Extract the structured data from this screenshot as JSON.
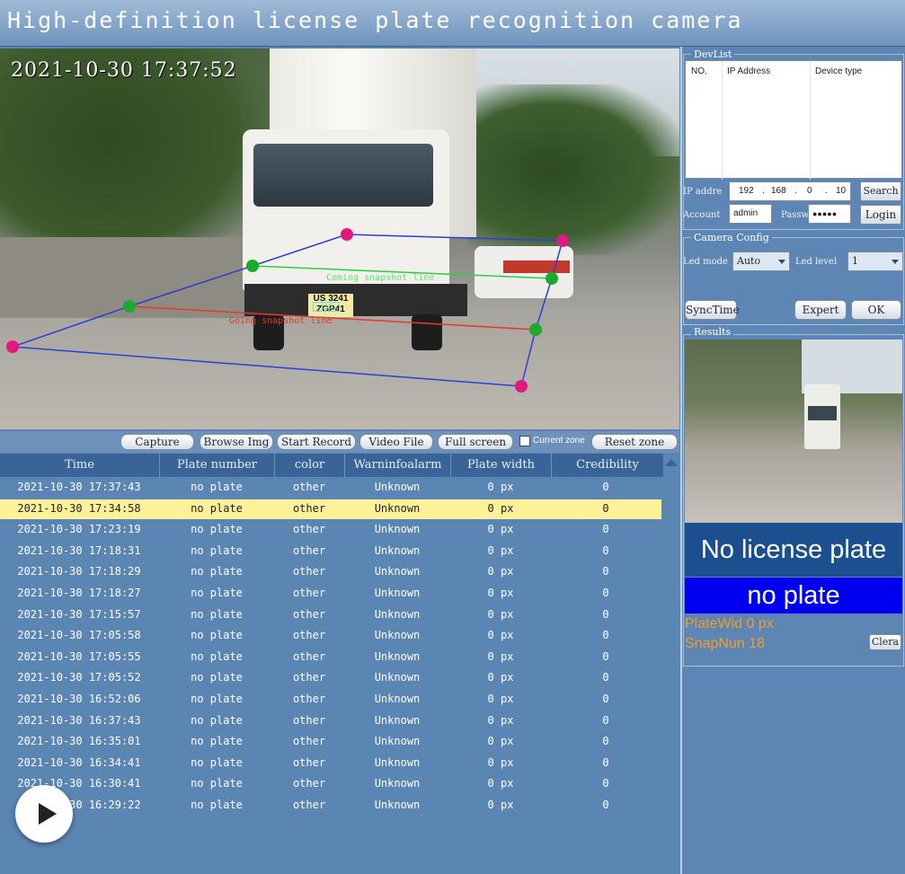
{
  "window": {
    "title": "High-definition license plate recognition camera"
  },
  "video": {
    "timestamp": "2021-10-30 17:37:52",
    "plate_text": "US 3241",
    "plate_text2": "ZGP41",
    "coming_label": "Coming  snapshot line",
    "going_label": "Going snapshot line",
    "mark_label": "-110-",
    "colors": {
      "region": "#2b3fd6",
      "coming": "#2ecc40",
      "going": "#e53b2b",
      "handle_end": "#e0197d",
      "handle_mid": "#1aaa2c"
    }
  },
  "toolbar": {
    "capture": "Capture",
    "browse": "Browse Img",
    "record": "Start Record",
    "video_file": "Video File",
    "full_screen": "Full screen",
    "current_zone": "Current zone",
    "reset_zone": "Reset zone"
  },
  "table": {
    "headers": [
      "Time",
      "Plate number",
      "color",
      "Warninfoalarm",
      "Plate width",
      "Credibility"
    ],
    "selected_index": 1,
    "rows": [
      [
        "2021-10-30 17:37:43",
        "no plate",
        "other",
        "Unknown",
        "0 px",
        "0"
      ],
      [
        "2021-10-30 17:34:58",
        "no plate",
        "other",
        "Unknown",
        "0 px",
        "0"
      ],
      [
        "2021-10-30 17:23:19",
        "no plate",
        "other",
        "Unknown",
        "0 px",
        "0"
      ],
      [
        "2021-10-30 17:18:31",
        "no plate",
        "other",
        "Unknown",
        "0 px",
        "0"
      ],
      [
        "2021-10-30 17:18:29",
        "no plate",
        "other",
        "Unknown",
        "0 px",
        "0"
      ],
      [
        "2021-10-30 17:18:27",
        "no plate",
        "other",
        "Unknown",
        "0 px",
        "0"
      ],
      [
        "2021-10-30 17:15:57",
        "no plate",
        "other",
        "Unknown",
        "0 px",
        "0"
      ],
      [
        "2021-10-30 17:05:58",
        "no plate",
        "other",
        "Unknown",
        "0 px",
        "0"
      ],
      [
        "2021-10-30 17:05:55",
        "no plate",
        "other",
        "Unknown",
        "0 px",
        "0"
      ],
      [
        "2021-10-30 17:05:52",
        "no plate",
        "other",
        "Unknown",
        "0 px",
        "0"
      ],
      [
        "2021-10-30 16:52:06",
        "no plate",
        "other",
        "Unknown",
        "0 px",
        "0"
      ],
      [
        "2021-10-30 16:37:43",
        "no plate",
        "other",
        "Unknown",
        "0 px",
        "0"
      ],
      [
        "2021-10-30 16:35:01",
        "no plate",
        "other",
        "Unknown",
        "0 px",
        "0"
      ],
      [
        "2021-10-30 16:34:41",
        "no plate",
        "other",
        "Unknown",
        "0 px",
        "0"
      ],
      [
        "2021-10-30 16:30:41",
        "no plate",
        "other",
        "Unknown",
        "0 px",
        "0"
      ],
      [
        "2021-10-30 16:29:22",
        "no plate",
        "other",
        "Unknown",
        "0 px",
        "0"
      ]
    ]
  },
  "devlist": {
    "label": "DevList",
    "col_no": "NO.",
    "col_ip": "IP Address",
    "col_type": "Device type",
    "ip_label": "IP addre",
    "ip": [
      "192",
      "168",
      "0",
      "10"
    ],
    "account_label": "Account",
    "account_value": "admin",
    "password_label": "Passw",
    "password_value": "●●●●●",
    "search": "Search",
    "login": "Login"
  },
  "camera_config": {
    "label": "Camera Config",
    "led_mode_label": "Led mode",
    "led_mode_value": "Auto",
    "led_level_label": "Led level",
    "led_level_value": "1",
    "sync_time": "SyncTime",
    "expert": "Expert",
    "ok": "OK"
  },
  "results": {
    "label": "Results",
    "no_license": "No license plate",
    "no_plate": "no plate",
    "plate_width": "PlateWid 0 px",
    "snap_num": "SnapNun 18",
    "clear": "Clera"
  },
  "player": {
    "icon": "play-icon"
  }
}
